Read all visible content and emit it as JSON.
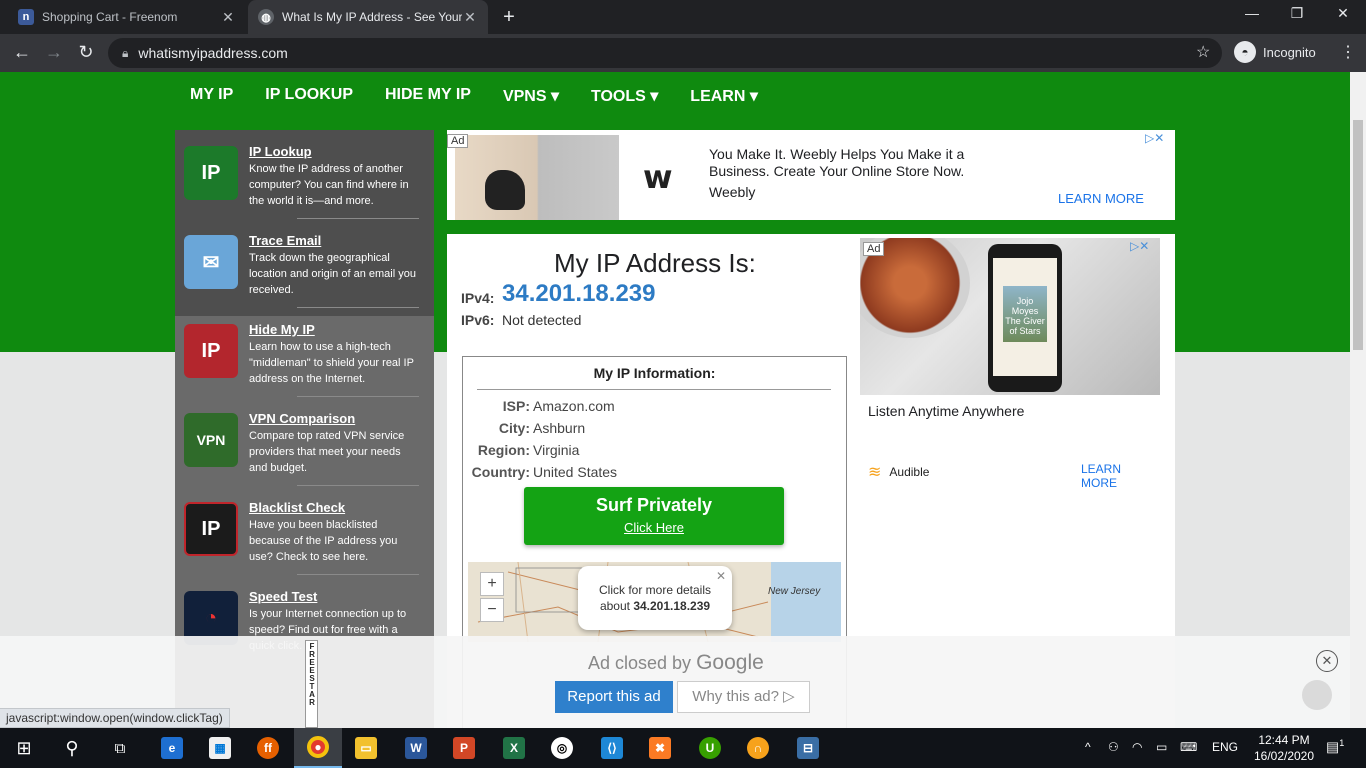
{
  "browser": {
    "tabs": [
      {
        "title": "Shopping Cart - Freenom",
        "icon": "freenom-icon"
      },
      {
        "title": "What Is My IP Address - See Your",
        "icon": "globe-icon"
      }
    ],
    "url": "whatismyipaddress.com",
    "profile": "Incognito"
  },
  "nav": {
    "items": [
      "MY IP",
      "IP LOOKUP",
      "HIDE MY IP",
      "VPNS ▾",
      "TOOLS ▾",
      "LEARN ▾"
    ]
  },
  "sidebar": {
    "items": [
      {
        "title": "IP Lookup",
        "desc": "Know the IP address of another computer? You can find where in the world it is—and more.",
        "tile": "IP"
      },
      {
        "title": "Trace Email",
        "desc": "Track down the geographical location and origin of an email you received.",
        "tile": "✉"
      },
      {
        "title": "Hide My IP",
        "desc": "Learn how to use a high-tech \"middleman\" to shield your real IP address on the Internet.",
        "tile": "IP"
      },
      {
        "title": "VPN Comparison",
        "desc": "Compare top rated VPN service providers that meet your needs and budget.",
        "tile": "VPN"
      },
      {
        "title": "Blacklist Check",
        "desc": "Have you been blacklisted because of the IP address you use? Check to see here.",
        "tile": "IP"
      },
      {
        "title": "Speed Test",
        "desc": "Is your Internet connection up to speed? Find out for free with a quick click.",
        "tile": "◔"
      }
    ]
  },
  "top_ad": {
    "tag": "Ad",
    "text": "You Make It. Weebly Helps You Make it a Business. Create Your Online Store Now.",
    "brand": "Weebly",
    "cta": "LEARN MORE"
  },
  "ip": {
    "heading": "My IP Address Is:",
    "ipv4_label": "IPv4:",
    "ipv4": "34.201.18.239",
    "ipv6_label": "IPv6:",
    "ipv6": "Not detected"
  },
  "info": {
    "heading": "My IP Information:",
    "rows": [
      {
        "k": "ISP:",
        "v": "Amazon.com"
      },
      {
        "k": "City:",
        "v": "Ashburn"
      },
      {
        "k": "Region:",
        "v": "Virginia"
      },
      {
        "k": "Country:",
        "v": "United States"
      }
    ],
    "surf_title": "Surf Privately",
    "surf_link": "Click Here",
    "map_label": "New Jersey",
    "popup_line1": "Click for more details",
    "popup_line2_prefix": "about ",
    "popup_ip": "34.201.18.239"
  },
  "right_ad": {
    "tag": "Ad",
    "book_title": "Jojo Moyes The Giver of Stars",
    "caption": "Listen Anytime Anywhere",
    "brand": "Audible",
    "cta": "LEARN MORE"
  },
  "ad_closed": {
    "msg": "Ad closed by",
    "google": "Google",
    "report": "Report this ad",
    "why": "Why this ad? ▷",
    "freestar": "FREESTAR"
  },
  "status_url": "javascript:window.open(window.clickTag)",
  "taskbar": {
    "lang": "ENG",
    "time": "12:44 PM",
    "date": "16/02/2020",
    "notif_count": "1"
  },
  "colors": {
    "green_band": "#0f8a0f",
    "ip_blue": "#2d7bc4",
    "surf_green": "#14a314",
    "link_blue": "#1a73e8"
  }
}
